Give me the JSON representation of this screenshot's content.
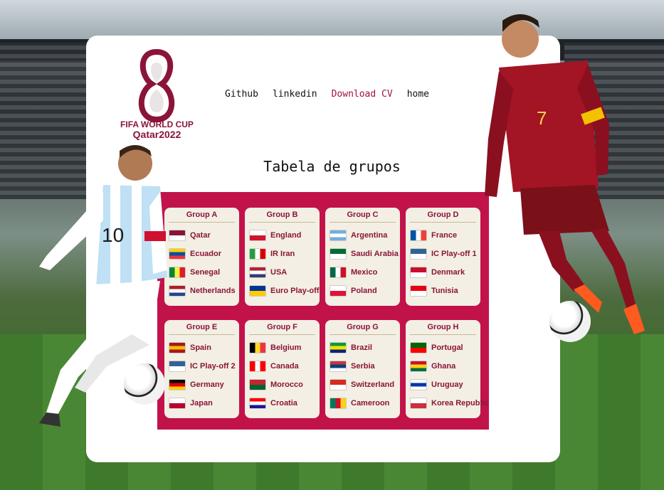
{
  "nav": {
    "github": "Github",
    "linkedin": "linkedin",
    "download_cv": "Download CV",
    "home": "home"
  },
  "logo": {
    "line1": "FIFA WORLD CUP",
    "line2": "Qatar2022"
  },
  "page_title": "Tabela de grupos",
  "groups": [
    {
      "name": "Group A",
      "teams": [
        {
          "name": "Qatar",
          "colors": [
            "#8a1538",
            "#ffffff"
          ]
        },
        {
          "name": "Ecuador",
          "colors": [
            "#ffd100",
            "#034ea2",
            "#ef3340"
          ]
        },
        {
          "name": "Senegal",
          "colors": [
            "#00853f",
            "#fdef42",
            "#e31b23"
          ]
        },
        {
          "name": "Netherlands",
          "colors": [
            "#ae1c28",
            "#ffffff",
            "#21468b"
          ]
        }
      ]
    },
    {
      "name": "Group B",
      "teams": [
        {
          "name": "England",
          "colors": [
            "#ffffff",
            "#cf142b"
          ]
        },
        {
          "name": "IR Iran",
          "colors": [
            "#239f40",
            "#ffffff",
            "#da0000"
          ]
        },
        {
          "name": "USA",
          "colors": [
            "#b22234",
            "#ffffff",
            "#3c3b6e"
          ]
        },
        {
          "name": "Euro Play-off",
          "colors": [
            "#003399",
            "#ffcc00"
          ]
        }
      ]
    },
    {
      "name": "Group C",
      "teams": [
        {
          "name": "Argentina",
          "colors": [
            "#74acdf",
            "#ffffff",
            "#74acdf"
          ]
        },
        {
          "name": "Saudi Arabia",
          "colors": [
            "#006c35",
            "#ffffff"
          ]
        },
        {
          "name": "Mexico",
          "colors": [
            "#006847",
            "#ffffff",
            "#ce1126"
          ]
        },
        {
          "name": "Poland",
          "colors": [
            "#ffffff",
            "#dc143c"
          ]
        }
      ]
    },
    {
      "name": "Group D",
      "teams": [
        {
          "name": "France",
          "colors": [
            "#0055a4",
            "#ffffff",
            "#ef4135"
          ]
        },
        {
          "name": "IC Play-off 1",
          "colors": [
            "#326295",
            "#ffffff"
          ]
        },
        {
          "name": "Denmark",
          "colors": [
            "#c8102e",
            "#ffffff"
          ]
        },
        {
          "name": "Tunisia",
          "colors": [
            "#e70013",
            "#ffffff"
          ]
        }
      ]
    },
    {
      "name": "Group E",
      "teams": [
        {
          "name": "Spain",
          "colors": [
            "#aa151b",
            "#f1bf00",
            "#aa151b"
          ]
        },
        {
          "name": "IC Play-off 2",
          "colors": [
            "#326295",
            "#ffffff"
          ]
        },
        {
          "name": "Germany",
          "colors": [
            "#000000",
            "#dd0000",
            "#ffce00"
          ]
        },
        {
          "name": "Japan",
          "colors": [
            "#ffffff",
            "#bc002d"
          ]
        }
      ]
    },
    {
      "name": "Group F",
      "teams": [
        {
          "name": "Belgium",
          "colors": [
            "#000000",
            "#fdda24",
            "#ef3340"
          ]
        },
        {
          "name": "Canada",
          "colors": [
            "#ff0000",
            "#ffffff",
            "#ff0000"
          ]
        },
        {
          "name": "Morocco",
          "colors": [
            "#c1272d",
            "#006233"
          ]
        },
        {
          "name": "Croatia",
          "colors": [
            "#ff0000",
            "#ffffff",
            "#171796"
          ]
        }
      ]
    },
    {
      "name": "Group G",
      "teams": [
        {
          "name": "Brazil",
          "colors": [
            "#009c3b",
            "#ffdf00",
            "#002776"
          ]
        },
        {
          "name": "Serbia",
          "colors": [
            "#c6363c",
            "#0c4076",
            "#ffffff"
          ]
        },
        {
          "name": "Switzerland",
          "colors": [
            "#d52b1e",
            "#ffffff"
          ]
        },
        {
          "name": "Cameroon",
          "colors": [
            "#007a5e",
            "#ce1126",
            "#fcd116"
          ]
        }
      ]
    },
    {
      "name": "Group H",
      "teams": [
        {
          "name": "Portugal",
          "colors": [
            "#006600",
            "#ff0000"
          ]
        },
        {
          "name": "Ghana",
          "colors": [
            "#ce1126",
            "#fcd116",
            "#006b3f"
          ]
        },
        {
          "name": "Uruguay",
          "colors": [
            "#ffffff",
            "#0038a8",
            "#ffffff"
          ]
        },
        {
          "name": "Korea Republic",
          "colors": [
            "#ffffff",
            "#cd2e3a"
          ]
        }
      ]
    }
  ],
  "colors": {
    "brand": "#8a1538",
    "groups_background": "#c2124a",
    "nav_highlight": "#a0123c"
  }
}
